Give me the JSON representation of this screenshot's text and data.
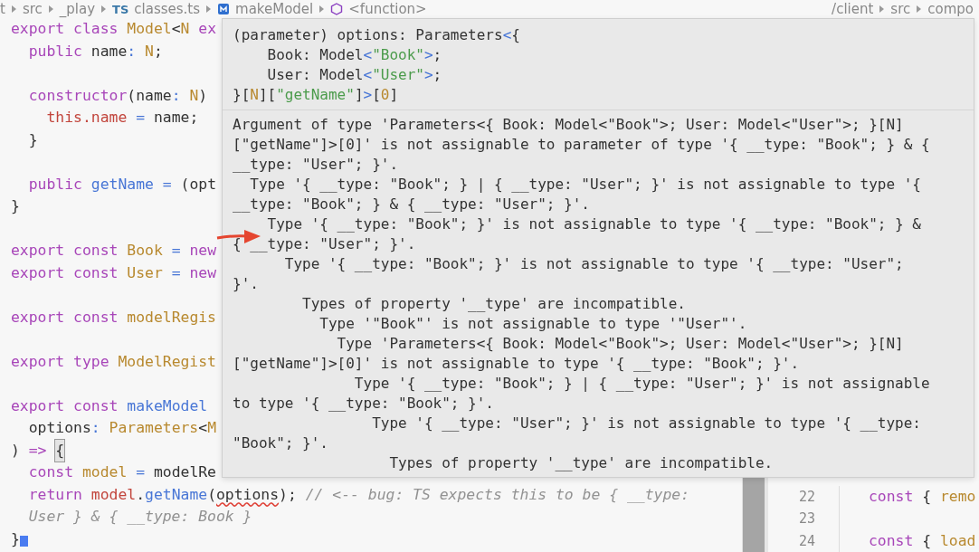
{
  "breadcrumb": {
    "left": [
      {
        "text": "t"
      },
      {
        "text": "src"
      },
      {
        "text": "_play"
      },
      {
        "text": "classes.ts",
        "badge": "TS"
      },
      {
        "text": "makeModel",
        "kind": "method"
      },
      {
        "text": "<function>",
        "kind": "function"
      }
    ],
    "right": [
      {
        "text": "/client"
      },
      {
        "text": "src"
      },
      {
        "text": "compo"
      }
    ]
  },
  "editor": {
    "lines": [
      {
        "tokens": [
          {
            "text": "export",
            "kind": "kw"
          },
          {
            "text": " class",
            "kind": "kw"
          },
          {
            "text": " Model",
            "kind": "type"
          },
          {
            "text": "<",
            "kind": "plain"
          },
          {
            "text": "N",
            "kind": "type"
          },
          {
            "text": " ex",
            "kind": "kw"
          }
        ]
      },
      {
        "tokens": [
          {
            "text": "  public",
            "kind": "kw"
          },
          {
            "text": " name",
            "kind": "plain"
          },
          {
            "text": ":",
            "kind": "op"
          },
          {
            "text": " N",
            "kind": "type"
          },
          {
            "text": ";",
            "kind": "plain"
          }
        ]
      },
      {
        "blank_before": true,
        "tokens": [
          {
            "text": "  constructor",
            "kind": "kw"
          },
          {
            "text": "(name",
            "kind": "plain"
          },
          {
            "text": ":",
            "kind": "op"
          },
          {
            "text": " N",
            "kind": "type"
          },
          {
            "text": ")",
            "kind": "plain"
          }
        ]
      },
      {
        "tokens": [
          {
            "text": "    this.name",
            "kind": "var"
          },
          {
            "text": " =",
            "kind": "op"
          },
          {
            "text": " name;",
            "kind": "plain"
          }
        ]
      },
      {
        "tokens": [
          {
            "text": "  }",
            "kind": "plain"
          }
        ]
      },
      {
        "blank_before": true,
        "tokens": [
          {
            "text": "  public",
            "kind": "kw"
          },
          {
            "text": " getName",
            "kind": "fn"
          },
          {
            "text": " =",
            "kind": "op"
          },
          {
            "text": " (opt",
            "kind": "plain"
          }
        ]
      },
      {
        "tokens": [
          {
            "text": "}",
            "kind": "plain"
          }
        ]
      },
      {
        "blank_before": true,
        "tokens": [
          {
            "text": "export",
            "kind": "kw"
          },
          {
            "text": " const",
            "kind": "kw"
          },
          {
            "text": " Book",
            "kind": "type"
          },
          {
            "text": " =",
            "kind": "op"
          },
          {
            "text": " new",
            "kind": "kw"
          }
        ]
      },
      {
        "tokens": [
          {
            "text": "export",
            "kind": "kw"
          },
          {
            "text": " const",
            "kind": "kw"
          },
          {
            "text": " User",
            "kind": "type"
          },
          {
            "text": " =",
            "kind": "op"
          },
          {
            "text": " new",
            "kind": "kw"
          }
        ]
      },
      {
        "blank_before": true,
        "tokens": [
          {
            "text": "export",
            "kind": "kw"
          },
          {
            "text": " const",
            "kind": "kw"
          },
          {
            "text": " modelRegis",
            "kind": "type"
          }
        ]
      },
      {
        "blank_before": true,
        "tokens": [
          {
            "text": "export",
            "kind": "kw"
          },
          {
            "text": " type",
            "kind": "kw"
          },
          {
            "text": " ModelRegist",
            "kind": "type"
          }
        ]
      },
      {
        "blank_before": true,
        "tokens": [
          {
            "text": "export",
            "kind": "kw"
          },
          {
            "text": " const",
            "kind": "kw"
          },
          {
            "text": " makeModel",
            "kind": "fn"
          }
        ]
      },
      {
        "tokens": [
          {
            "text": "  options",
            "kind": "plain"
          },
          {
            "text": ":",
            "kind": "op"
          },
          {
            "text": " Parameters",
            "kind": "type"
          },
          {
            "text": "<",
            "kind": "plain"
          },
          {
            "text": "M",
            "kind": "type"
          }
        ]
      },
      {
        "tokens": [
          {
            "text": ")",
            "kind": "plain"
          },
          {
            "text": " => ",
            "kind": "kw"
          },
          {
            "text": "{",
            "kind": "match"
          }
        ]
      },
      {
        "tokens": [
          {
            "text": "  const",
            "kind": "kw"
          },
          {
            "text": " model",
            "kind": "type"
          },
          {
            "text": " =",
            "kind": "op"
          },
          {
            "text": " modelRe",
            "kind": "plain"
          }
        ]
      },
      {
        "tokens": [
          {
            "text": "  return",
            "kind": "kw"
          },
          {
            "text": " model",
            "kind": "var"
          },
          {
            "text": ".",
            "kind": "plain"
          },
          {
            "text": "getName",
            "kind": "fn"
          },
          {
            "text": "(",
            "kind": "plain"
          },
          {
            "text": "options",
            "kind": "err"
          },
          {
            "text": ");",
            "kind": "plain"
          },
          {
            "text": " // <-- bug: TS expects this to be { __type:",
            "kind": "comment"
          }
        ]
      },
      {
        "tokens": [
          {
            "text": "  User } & { __type: Book }",
            "kind": "comment"
          }
        ]
      },
      {
        "cursor": true,
        "tokens": [
          {
            "text": "}",
            "kind": "plain"
          }
        ]
      }
    ]
  },
  "side_pane": {
    "lines": [
      {
        "number": "22",
        "tokens": [
          {
            "text": "const",
            "kind": "kw"
          },
          {
            "text": " {",
            "kind": "plain"
          },
          {
            "text": " remo",
            "kind": "type"
          }
        ]
      },
      {
        "number": "23"
      },
      {
        "number": "24",
        "tokens": [
          {
            "text": "const",
            "kind": "kw"
          },
          {
            "text": " {",
            "kind": "plain"
          },
          {
            "text": " load",
            "kind": "type"
          }
        ]
      }
    ]
  },
  "hover": {
    "signature": [
      [
        {
          "text": "(parameter) options: Parameters",
          "kind": "plain"
        },
        {
          "text": "<",
          "kind": "op"
        },
        {
          "text": "{",
          "kind": "plain"
        }
      ],
      [
        {
          "text": "    Book: Model",
          "kind": "plain"
        },
        {
          "text": "<",
          "kind": "op"
        },
        {
          "text": "\"Book\"",
          "kind": "str"
        },
        {
          "text": ">",
          "kind": "op"
        },
        {
          "text": ";",
          "kind": "plain"
        }
      ],
      [
        {
          "text": "    User: Model",
          "kind": "plain"
        },
        {
          "text": "<",
          "kind": "op"
        },
        {
          "text": "\"User\"",
          "kind": "str"
        },
        {
          "text": ">",
          "kind": "op"
        },
        {
          "text": ";",
          "kind": "plain"
        }
      ],
      [
        {
          "text": "}[",
          "kind": "plain"
        },
        {
          "text": "N",
          "kind": "type"
        },
        {
          "text": "][",
          "kind": "plain"
        },
        {
          "text": "\"getName\"",
          "kind": "str"
        },
        {
          "text": "]",
          "kind": "plain"
        },
        {
          "text": ">",
          "kind": "op"
        },
        {
          "text": "[",
          "kind": "plain"
        },
        {
          "text": "0",
          "kind": "type"
        },
        {
          "text": "]",
          "kind": "plain"
        }
      ]
    ],
    "message": [
      "Argument of type 'Parameters<{ Book: Model<\"Book\">; User: Model<\"User\">; }[N]",
      "[\"getName\"]>[0]' is not assignable to parameter of type '{ __type: \"Book\"; } & {",
      "__type: \"User\"; }'.",
      "  Type '{ __type: \"Book\"; } | { __type: \"User\"; }' is not assignable to type '{",
      "__type: \"Book\"; } & { __type: \"User\"; }'.",
      "    Type '{ __type: \"Book\"; }' is not assignable to type '{ __type: \"Book\"; } &",
      "{ __type: \"User\"; }'.",
      "      Type '{ __type: \"Book\"; }' is not assignable to type '{ __type: \"User\";",
      "}'.",
      "        Types of property '__type' are incompatible.",
      "          Type '\"Book\"' is not assignable to type '\"User\"'.",
      "            Type 'Parameters<{ Book: Model<\"Book\">; User: Model<\"User\">; }[N]",
      "[\"getName\"]>[0]' is not assignable to type '{ __type: \"Book\"; }'.",
      "              Type '{ __type: \"Book\"; } | { __type: \"User\"; }' is not assignable",
      "to type '{ __type: \"Book\"; }'.",
      "                Type '{ __type: \"User\"; }' is not assignable to type '{ __type:",
      "\"Book\"; }'.",
      "                  Types of property '__type' are incompatible."
    ]
  }
}
